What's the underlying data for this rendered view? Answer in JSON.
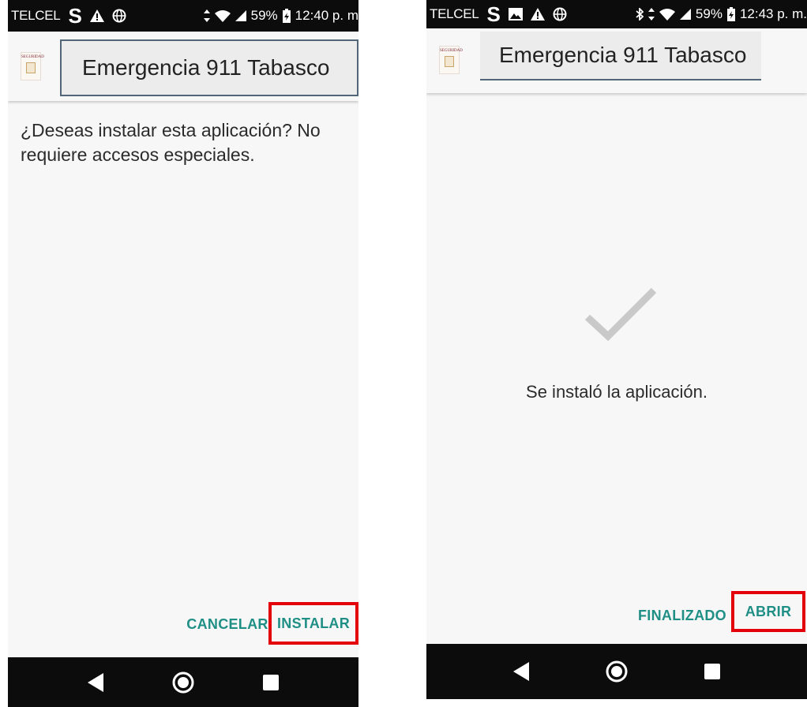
{
  "left_screen": {
    "status_bar": {
      "carrier": "TELCEL",
      "s_glyph": "S",
      "battery": "59%",
      "time": "12:40 p. m"
    },
    "header": {
      "logo_text": "SEGURIDAD",
      "title": "Emergencia 911 Tabasco"
    },
    "message": "¿Deseas instalar esta aplicación? No requiere accesos especiales.",
    "buttons": {
      "cancel": "CANCELAR",
      "install": "INSTALAR"
    },
    "highlight_color": "#e3000b",
    "accent_color": "#1f8f86",
    "icons": [
      "alert-icon",
      "globe-icon",
      "data-arrows-icon",
      "wifi-icon",
      "signal-icon",
      "battery-icon",
      "back-icon",
      "home-icon",
      "recents-icon"
    ]
  },
  "right_screen": {
    "status_bar": {
      "carrier": "TELCEL",
      "s_glyph": "S",
      "battery": "59%",
      "time": "12:43 p. m."
    },
    "header": {
      "logo_text": "SEGURIDAD",
      "title": "Emergencia 911 Tabasco"
    },
    "message": "Se instaló la aplicación.",
    "buttons": {
      "finished": "FINALIZADO",
      "open": "ABRIR"
    },
    "highlight_color": "#e3000b",
    "accent_color": "#1f8f86",
    "icons": [
      "image-icon",
      "alert-icon",
      "globe-icon",
      "bluetooth-icon",
      "data-arrows-icon",
      "wifi-icon",
      "signal-icon",
      "battery-icon",
      "checkmark-icon",
      "back-icon",
      "home-icon",
      "recents-icon"
    ]
  }
}
